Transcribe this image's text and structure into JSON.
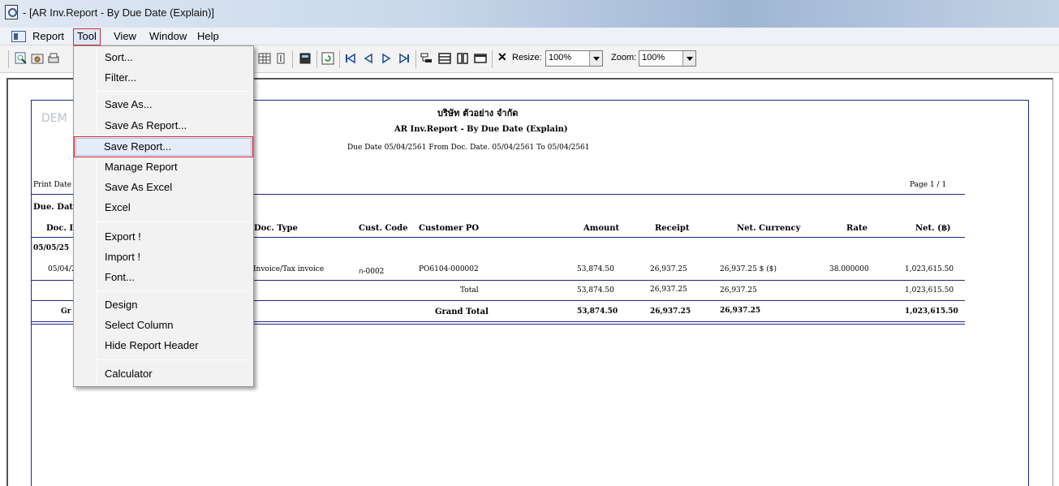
{
  "window": {
    "title": "- [AR Inv.Report - By Due Date (Explain)]"
  },
  "menubar": {
    "items": [
      "Report",
      "Tool",
      "View",
      "Window",
      "Help"
    ]
  },
  "toolbar": {
    "resize_label": "Resize:",
    "resize_value": "100%",
    "zoom_label": "Zoom:",
    "zoom_value": "100%",
    "close_glyph": "✕"
  },
  "tool_menu": {
    "items": [
      "Sort...",
      "Filter...",
      "Save As...",
      "Save As Report...",
      "Save Report...",
      "Manage Report",
      "Save As Excel",
      "Excel",
      "Export !",
      "Import !",
      "Font...",
      "Design",
      "Select Column",
      "Hide Report Header",
      "Calculator"
    ],
    "highlighted": "Save Report..."
  },
  "report": {
    "watermark": "DEM",
    "company": "บริษัท ตัวอย่าง จำกัด",
    "title": "AR Inv.Report - By Due Date (Explain)",
    "subtitle": "Due Date 05/04/2561 From Doc. Date. 05/04/2561 To 05/04/2561",
    "print_date_label": "Print Date",
    "page": "Page 1 / 1",
    "group_header": "Due. Dat",
    "columns": {
      "doc": "Doc. I",
      "doc_type": "Doc. Type",
      "cust_code": "Cust. Code",
      "customer_po": "Customer PO",
      "amount": "Amount",
      "receipt": "Receipt",
      "net_currency": "Net. Currency",
      "rate": "Rate",
      "net_baht": "Net. (฿)"
    },
    "group_date": "05/05/25",
    "row": {
      "doc": "05/04/2",
      "doc_type": "Invoice/Tax invoice",
      "cust_code": "ก-0002",
      "customer_po": "PO6104-000002",
      "amount": "53,874.50",
      "receipt": "26,937.25",
      "net_currency": "26,937.25 $ ($)",
      "rate": "38.000000",
      "net_baht": "1,023,615.50"
    },
    "total": {
      "left_label": "",
      "label": "Total",
      "amount": "53,874.50",
      "receipt": "26,937.25",
      "net_currency": "26,937.25",
      "net_baht": "1,023,615.50"
    },
    "grand_total": {
      "left_label": "Gr",
      "label": "Grand Total",
      "amount": "53,874.50",
      "receipt": "26,937.25",
      "net_currency": "26,937.25",
      "net_baht": "1,023,615.50"
    }
  }
}
